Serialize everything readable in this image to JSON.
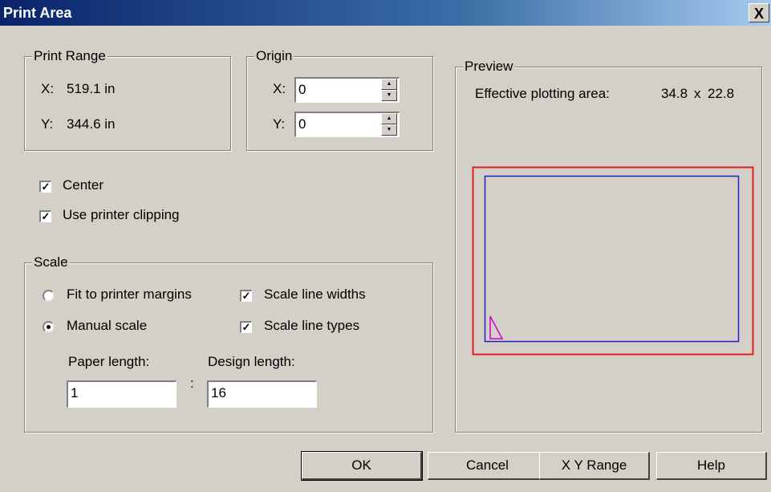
{
  "window": {
    "title": "Print Area",
    "close_glyph": "X"
  },
  "print_range": {
    "legend": "Print Range",
    "x_label": "X:",
    "x_value": "519.1 in",
    "y_label": "Y:",
    "y_value": "344.6 in"
  },
  "origin": {
    "legend": "Origin",
    "x_label": "X:",
    "x_value": "0",
    "y_label": "Y:",
    "y_value": "0"
  },
  "options": {
    "center_label": "Center",
    "center_checked": true,
    "clipping_label": "Use printer clipping",
    "clipping_checked": true
  },
  "scale": {
    "legend": "Scale",
    "fit_label": "Fit to printer margins",
    "manual_label": "Manual scale",
    "selected": "manual",
    "line_widths_label": "Scale line widths",
    "line_widths_checked": true,
    "line_types_label": "Scale line types",
    "line_types_checked": true,
    "paper_length_label": "Paper length:",
    "paper_length_value": "1",
    "separator": ":",
    "design_length_label": "Design length:",
    "design_length_value": "16"
  },
  "preview": {
    "legend": "Preview",
    "effective_label": "Effective plotting area:",
    "width": "34.8",
    "by": "x",
    "height": "22.8",
    "colors": {
      "paper": "#e02020",
      "area": "#2020c0",
      "origin_marker": "#d000d0"
    }
  },
  "buttons": {
    "ok": "OK",
    "cancel": "Cancel",
    "xy_range": "X Y Range",
    "help": "Help"
  }
}
